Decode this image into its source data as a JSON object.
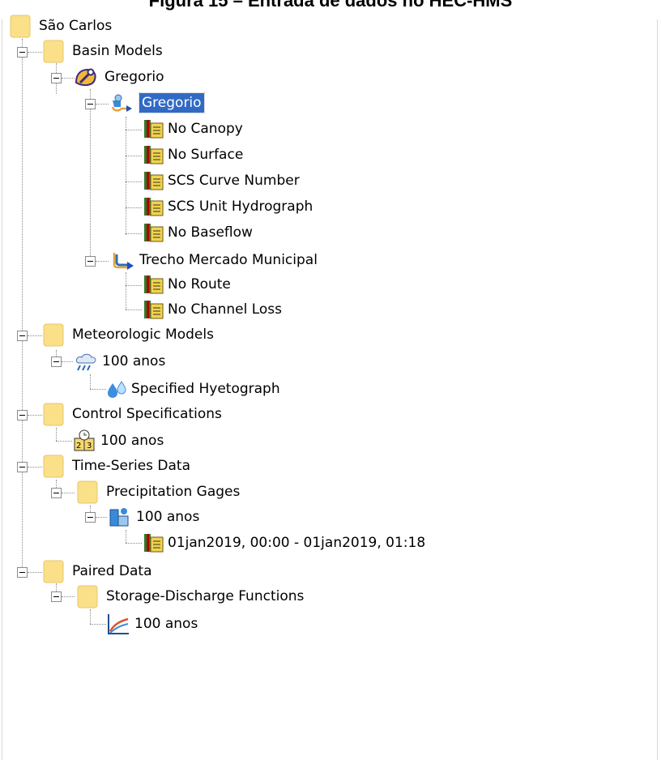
{
  "caption": "Figura 15 – Entrada de dados no HEC-HMS",
  "tree": {
    "root": "São Carlos",
    "basin_models": {
      "label": "Basin Models",
      "basin": {
        "label": "Gregorio",
        "subbasin": {
          "label": "Gregorio",
          "methods": [
            "No Canopy",
            "No Surface",
            "SCS Curve Number",
            "SCS Unit Hydrograph",
            "No Baseflow"
          ]
        },
        "reach": {
          "label": "Trecho Mercado Municipal",
          "methods": [
            "No Route",
            "No Channel Loss"
          ]
        }
      }
    },
    "meteorologic_models": {
      "label": "Meteorologic Models",
      "model": {
        "label": "100 anos",
        "method": "Specified Hyetograph"
      }
    },
    "control_specifications": {
      "label": "Control Specifications",
      "item": "100 anos"
    },
    "time_series": {
      "label": "Time-Series Data",
      "precip_gages": {
        "label": "Precipitation Gages",
        "gage": {
          "label": "100 anos",
          "window": "01jan2019, 00:00 - 01jan2019, 01:18"
        }
      }
    },
    "paired_data": {
      "label": "Paired Data",
      "storage_discharge": {
        "label": "Storage-Discharge Functions",
        "item": "100 anos"
      }
    }
  },
  "colors": {
    "folder": "#fbe08a",
    "selection": "#316ac5",
    "tree_lines": "#8c8c8c"
  }
}
